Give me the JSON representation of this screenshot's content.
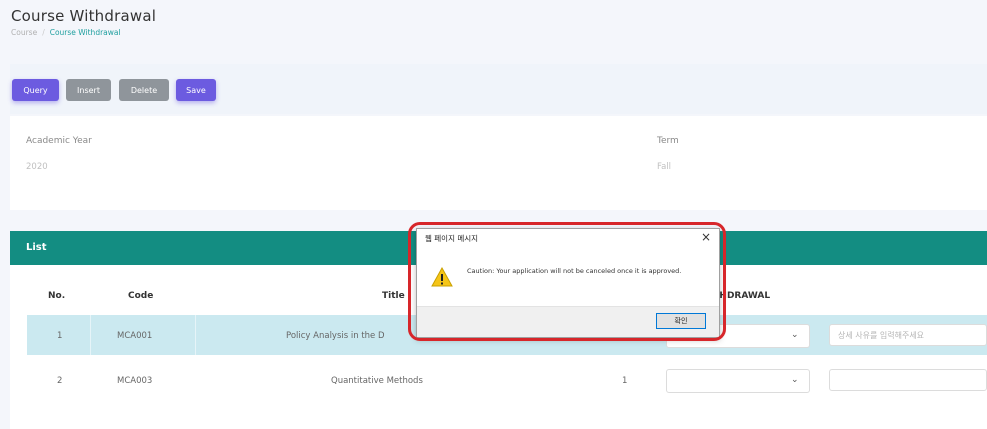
{
  "page": {
    "title": "Course Withdrawal"
  },
  "breadcrumb": {
    "root": "Course",
    "current": "Course Withdrawal"
  },
  "toolbar": {
    "query": "Query",
    "insert": "Insert",
    "delete": "Delete",
    "save": "Save"
  },
  "search": {
    "year_label": "Academic Year",
    "year_value": "2020",
    "term_label": "Term",
    "term_value": "Fall"
  },
  "list": {
    "title": "List",
    "columns": {
      "no": "No.",
      "code": "Code",
      "title": "Title",
      "withdrawal": "WITHDRAWAL"
    },
    "rows": [
      {
        "no": "1",
        "code": "MCA001",
        "title": "Policy Analysis in the D",
        "credits": "",
        "reason_placeholder": "상세 사유를 입력해주세요"
      },
      {
        "no": "2",
        "code": "MCA003",
        "title": "Quantitative Methods",
        "credits": "1",
        "reason_placeholder": ""
      }
    ]
  },
  "dialog": {
    "title": "웹 페이지 메시지",
    "message": "Caution: Your application will not be canceled once it is approved.",
    "ok": "확인",
    "icon": "warning-icon"
  },
  "colors": {
    "accent_purple": "#6c5be0",
    "gray_button": "#8f959b",
    "list_header": "#138d82",
    "selected_row": "#cbe9f0",
    "highlight_red": "#d7262a"
  }
}
